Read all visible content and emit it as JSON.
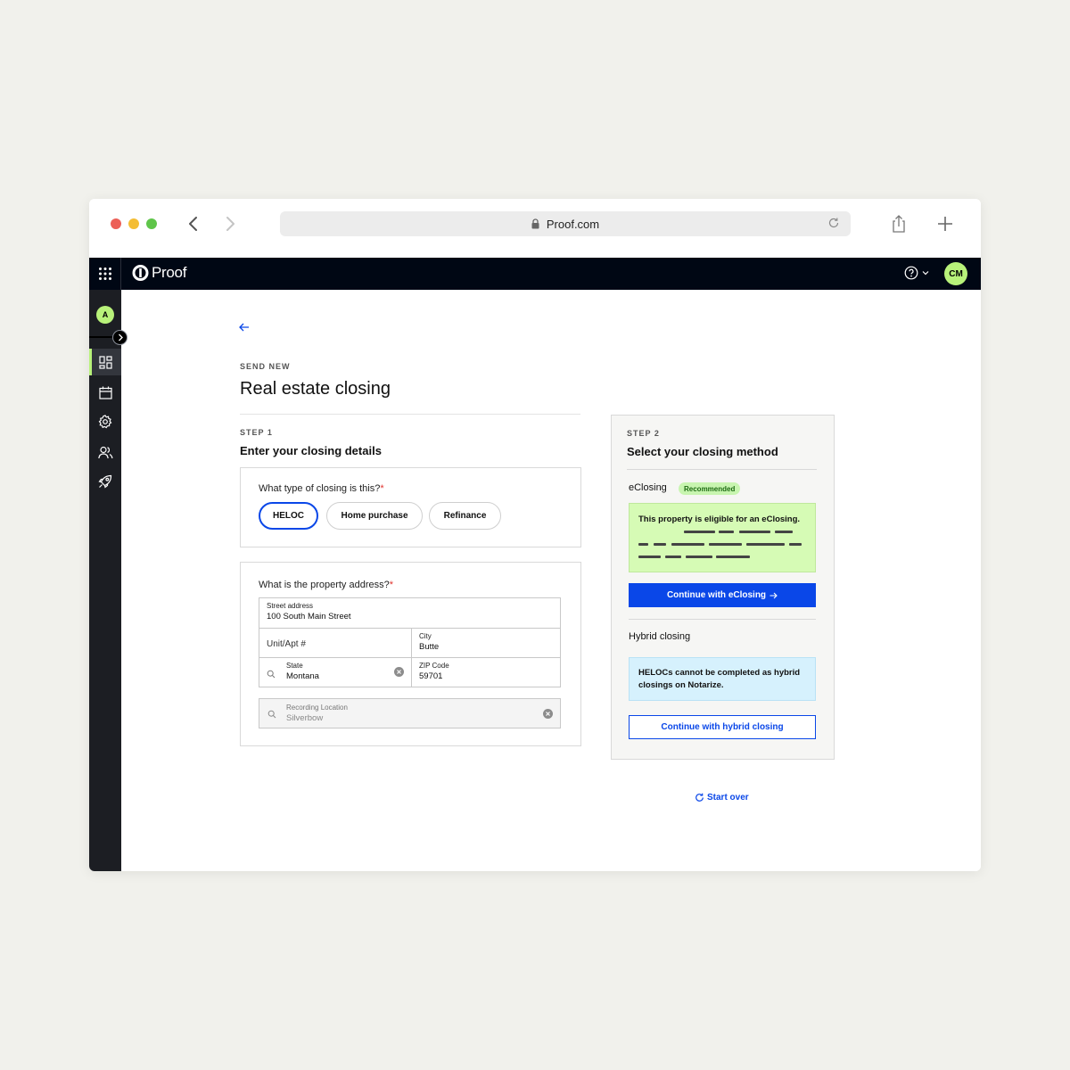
{
  "browser": {
    "url": "Proof.com"
  },
  "app": {
    "brand": "Proof",
    "user_initials": "CM",
    "org_initial": "A"
  },
  "sidebar": {
    "items": [
      {
        "icon": "dashboard-icon",
        "active": true
      },
      {
        "icon": "calendar-icon",
        "active": false
      },
      {
        "icon": "gear-icon",
        "active": false
      },
      {
        "icon": "users-icon",
        "active": false
      },
      {
        "icon": "rocket-icon",
        "active": false
      }
    ]
  },
  "page": {
    "eyebrow": "SEND NEW",
    "title": "Real estate closing"
  },
  "step1": {
    "label": "STEP 1",
    "title": "Enter your closing details",
    "closing_type": {
      "question": "What type of closing is this?",
      "required": "*",
      "options": [
        "HELOC",
        "Home purchase",
        "Refinance"
      ],
      "selected": "HELOC"
    },
    "address": {
      "question": "What is the property address?",
      "required": "*",
      "street_label": "Street address",
      "street_value": "100 South Main Street",
      "unit_placeholder": "Unit/Apt #",
      "city_label": "City",
      "city_value": "Butte",
      "state_label": "State",
      "state_value": "Montana",
      "zip_label": "ZIP Code",
      "zip_value": "59701",
      "recording_label": "Recording Location",
      "recording_value": "Silverbow"
    }
  },
  "step2": {
    "label": "STEP 2",
    "title": "Select your closing method",
    "eclosing": {
      "title": "eClosing",
      "badge": "Recommended",
      "message": "This property is eligible for an eClosing.",
      "button": "Continue with eClosing"
    },
    "hybrid": {
      "title": "Hybrid closing",
      "message": "HELOCs cannot be completed as hybrid closings on Notarize.",
      "button": "Continue with hybrid closing"
    },
    "start_over": "Start over"
  },
  "colors": {
    "accent_blue": "#0a47e8",
    "brand_green": "#b8f27a",
    "header_bg": "#000714"
  }
}
